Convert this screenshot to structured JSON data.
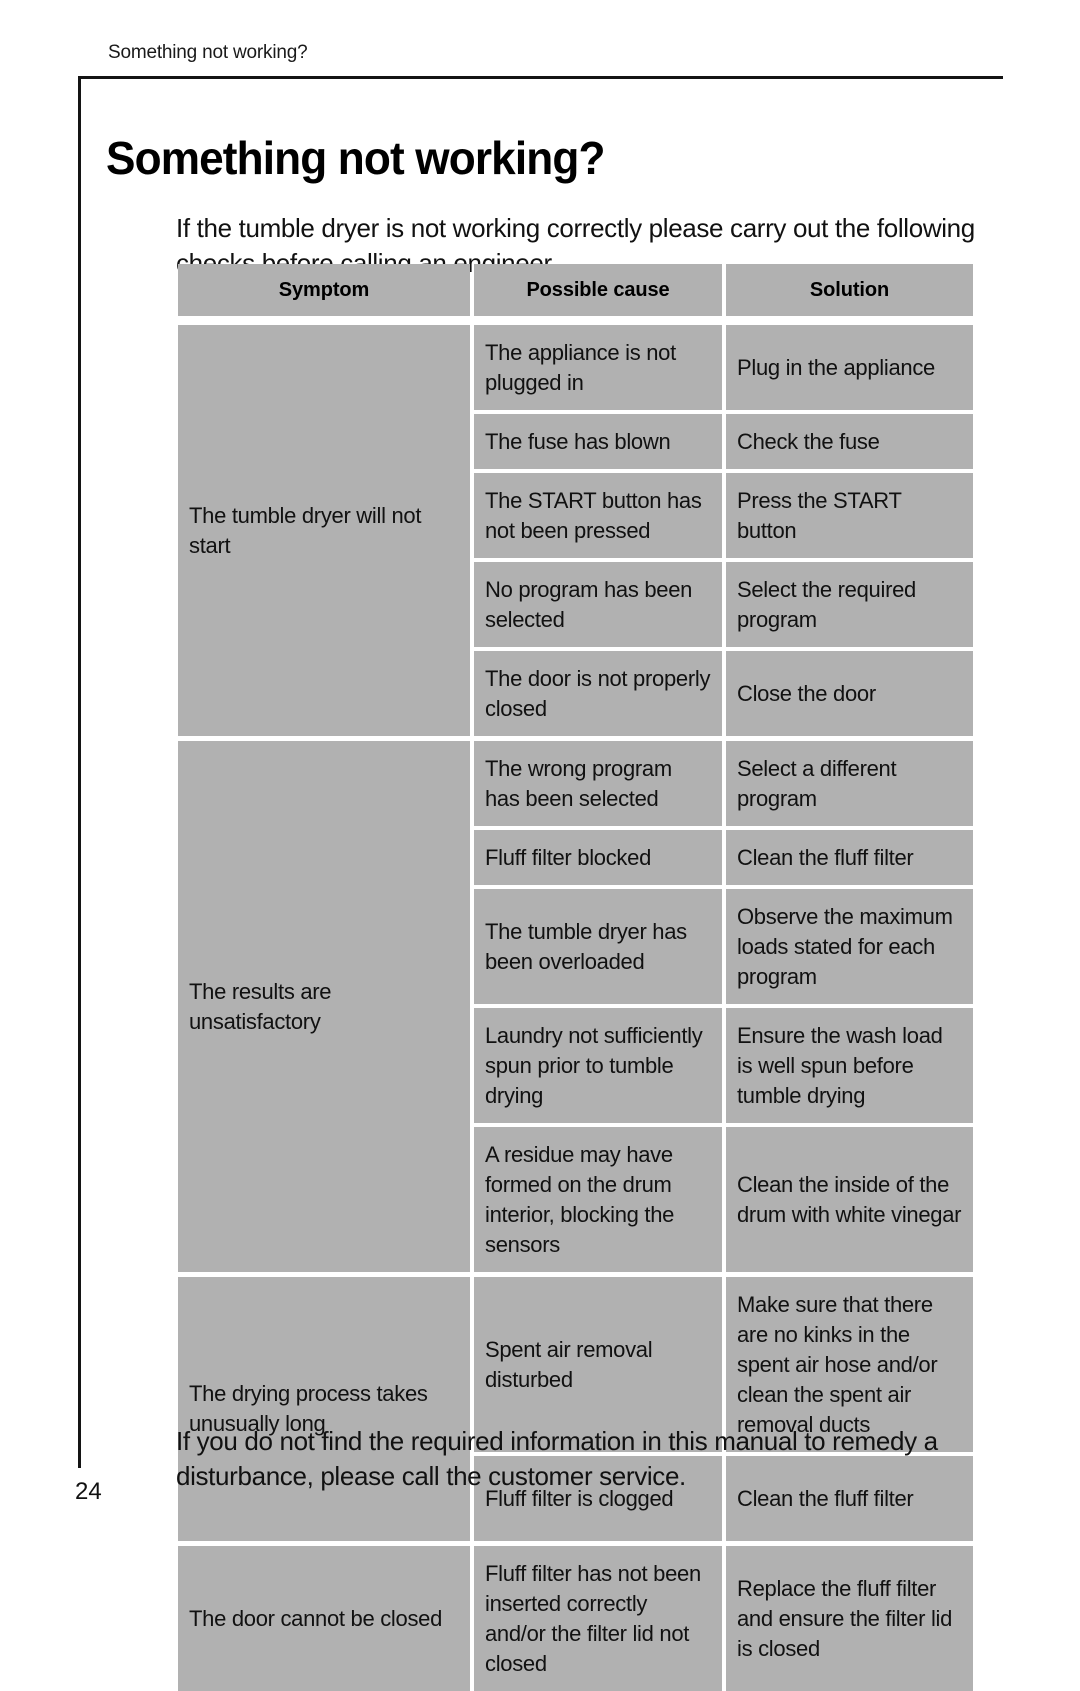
{
  "running_header": "Something not working?",
  "page_title": "Something not working?",
  "intro_paragraph": "If the tumble dryer is not working correctly please carry out the following checks before calling an engineer.",
  "outro_paragraph": "If you do not find the required information in this manual to remedy a disturbance, please call the customer service.",
  "page_number": "24",
  "colors": {
    "cell_background": "#b1b1b1",
    "rule": "#141414",
    "text": "#111111",
    "page_background": "#ffffff"
  },
  "table": {
    "headers": [
      "Symptom",
      "Possible cause",
      "Solution"
    ],
    "groups": [
      {
        "symptom": "The tumble dryer will not start",
        "rows": [
          {
            "cause": "The appliance is not plugged in",
            "solution": "Plug in the appliance"
          },
          {
            "cause": "The fuse has blown",
            "solution": "Check the fuse"
          },
          {
            "cause": "The START button has not been pressed",
            "solution": "Press the START button"
          },
          {
            "cause": "No program has been selected",
            "solution": "Select the required program"
          },
          {
            "cause": "The door is not properly closed",
            "solution": "Close the door"
          }
        ]
      },
      {
        "symptom": "The results are unsatisfactory",
        "rows": [
          {
            "cause": "The wrong program has been selected",
            "solution": "Select a different program"
          },
          {
            "cause": "Fluff filter blocked",
            "solution": "Clean the fluff filter"
          },
          {
            "cause": "The tumble dryer has been overloaded",
            "solution": "Observe the maximum loads stated for each program"
          },
          {
            "cause": "Laundry not sufficiently spun prior to tumble drying",
            "solution": "Ensure the wash load is well spun before tumble drying"
          },
          {
            "cause": "A residue may have formed on the drum interior, blocking the sensors",
            "solution": "Clean the inside of the drum with white vinegar"
          }
        ]
      },
      {
        "symptom": "The drying process takes unusually long",
        "rows": [
          {
            "cause": "Spent air removal disturbed",
            "solution": "Make sure that there are no kinks in the spent air hose and/or clean the spent air removal ducts"
          },
          {
            "cause": "Fluff filter is clogged",
            "solution": "Clean the fluff filter"
          }
        ]
      },
      {
        "symptom": "The door cannot be closed",
        "rows": [
          {
            "cause": "Fluff filter has not been inserted correctly and/or the filter lid not closed",
            "solution": "Replace the fluff filter and ensure the filter lid is closed"
          }
        ]
      }
    ]
  }
}
